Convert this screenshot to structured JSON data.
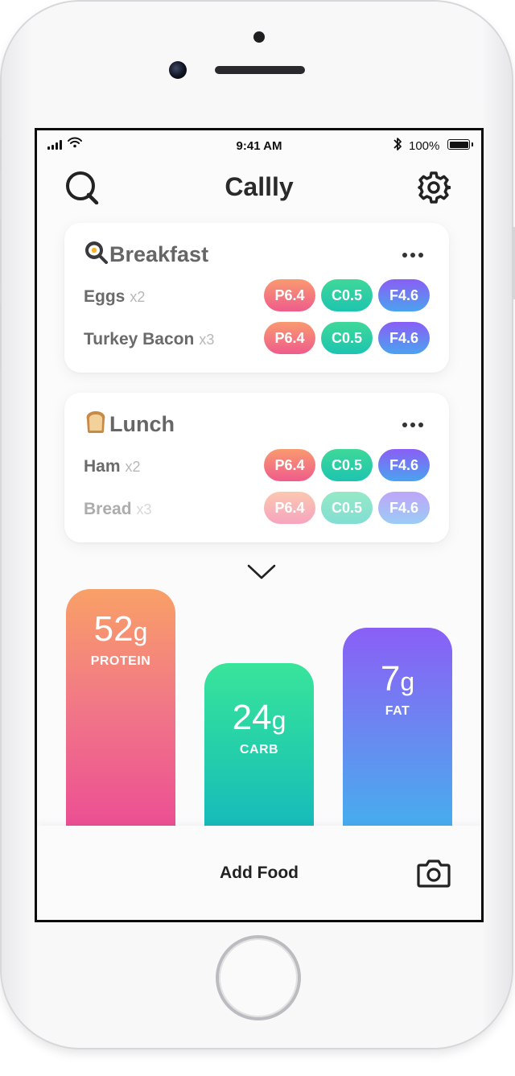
{
  "status_bar": {
    "time": "9:41 AM",
    "battery": "100%"
  },
  "header": {
    "title": "Callly"
  },
  "meals": [
    {
      "emoji": "🍳",
      "title": "Breakfast",
      "items": [
        {
          "name": "Eggs",
          "qty": "x2",
          "protein": "P6.4",
          "carb": "C0.5",
          "fat": "F4.6"
        },
        {
          "name": "Turkey Bacon",
          "qty": "x3",
          "protein": "P6.4",
          "carb": "C0.5",
          "fat": "F4.6"
        }
      ]
    },
    {
      "emoji": "🍞",
      "title": "Lunch",
      "items": [
        {
          "name": "Ham",
          "qty": "x2",
          "protein": "P6.4",
          "carb": "C0.5",
          "fat": "F4.6"
        },
        {
          "name": "Bread",
          "qty": "x3",
          "protein": "P6.4",
          "carb": "C0.5",
          "fat": "F4.6"
        }
      ]
    }
  ],
  "macros": [
    {
      "key": "protein",
      "value": "52",
      "unit": "g",
      "label": "PROTEIN"
    },
    {
      "key": "carb",
      "value": "24",
      "unit": "g",
      "label": "CARB"
    },
    {
      "key": "fat",
      "value": "7",
      "unit": "g",
      "label": "FAT"
    }
  ],
  "bottom_bar": {
    "add_food_label": "Add Food"
  },
  "colors": {
    "protein": "#f17787",
    "carb": "#24cfaa",
    "fat": "#6c86f1"
  },
  "icons": {
    "header_left": "search-icon",
    "header_right": "gear-icon",
    "card_menu": "more-icon",
    "expand": "chevron-down-icon",
    "bottom_right": "camera-icon"
  }
}
